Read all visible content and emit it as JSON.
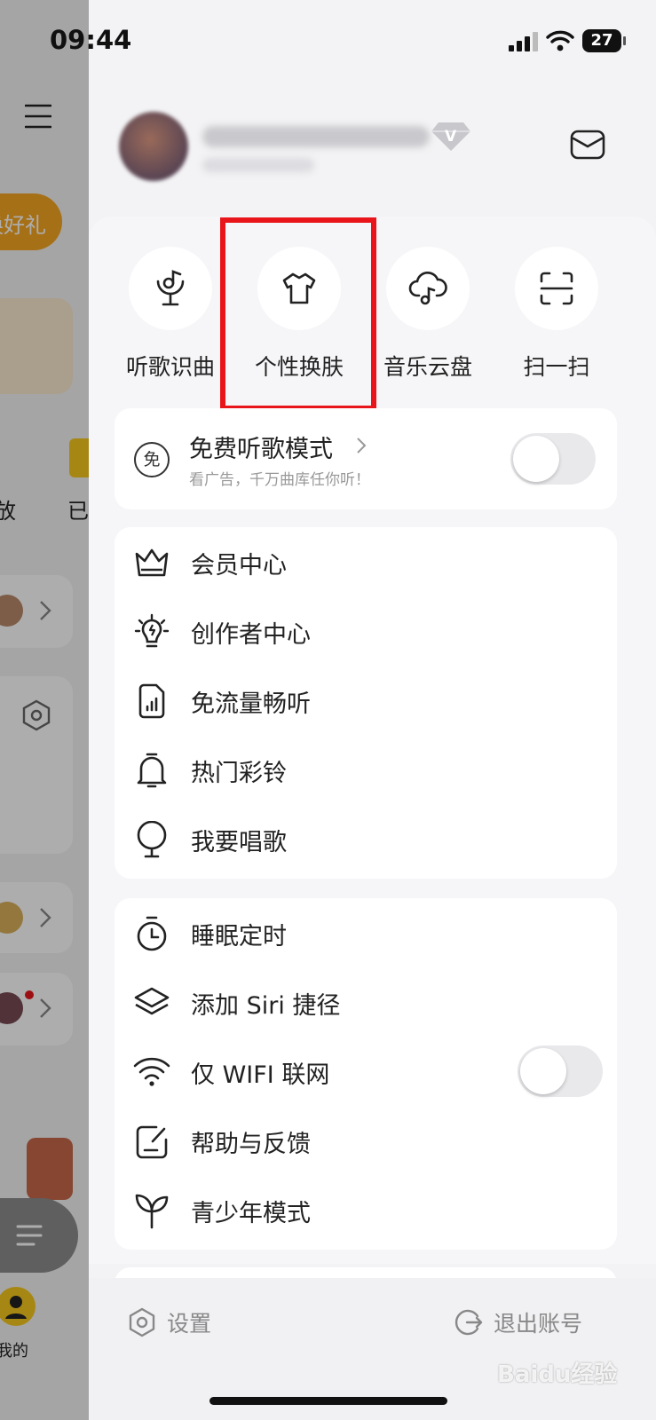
{
  "status_bar": {
    "time": "09:44",
    "battery": "27"
  },
  "background": {
    "pill_text": "换好礼",
    "label_a": "放",
    "label_b": "已",
    "mine_label": "我的"
  },
  "profile": {
    "vip_badge": "V"
  },
  "quick_actions": [
    {
      "label": "听歌识曲",
      "icon": "music-recognition-icon"
    },
    {
      "label": "个性换肤",
      "icon": "tshirt-icon"
    },
    {
      "label": "音乐云盘",
      "icon": "cloud-music-icon"
    },
    {
      "label": "扫一扫",
      "icon": "scan-icon"
    }
  ],
  "free_mode": {
    "badge": "免",
    "title": "免费听歌模式",
    "subtitle": "看广告，千万曲库任你听！",
    "enabled": false
  },
  "menu_group_1": [
    {
      "label": "会员中心",
      "icon": "crown-icon"
    },
    {
      "label": "创作者中心",
      "icon": "lightbulb-icon"
    },
    {
      "label": "免流量畅听",
      "icon": "data-card-icon"
    },
    {
      "label": "热门彩铃",
      "icon": "bell-icon"
    },
    {
      "label": "我要唱歌",
      "icon": "microphone-icon"
    }
  ],
  "menu_group_2": [
    {
      "label": "睡眠定时",
      "icon": "timer-icon"
    },
    {
      "label": "添加 Siri 捷径",
      "icon": "layers-icon"
    },
    {
      "label": "仅 WIFI 联网",
      "icon": "wifi-icon",
      "toggle": false
    },
    {
      "label": "帮助与反馈",
      "icon": "feedback-icon"
    },
    {
      "label": "青少年模式",
      "icon": "sprout-icon"
    }
  ],
  "footer": {
    "settings": "设置",
    "logout": "退出账号"
  },
  "watermark": {
    "text": "Baidu经验"
  },
  "colors": {
    "highlight": "#e8161b",
    "accent": "#f5a623"
  }
}
